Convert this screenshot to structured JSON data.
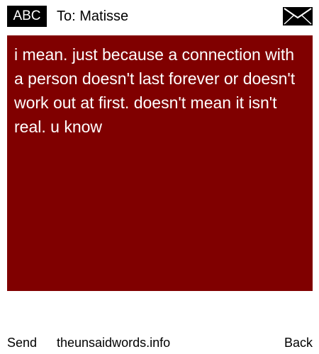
{
  "header": {
    "mode_label": "ABC",
    "recipient": "To: Matisse",
    "envelope_icon": "envelope-icon"
  },
  "message": {
    "text": "i mean. just because a connection with a person doesn't last forever or doesn't work out at first. doesn't mean it isn't real. u know",
    "background_color": "#800000",
    "text_color": "#ffffff"
  },
  "footer": {
    "send_label": "Send",
    "site": "theunsaidwords.info",
    "back_label": "Back"
  }
}
